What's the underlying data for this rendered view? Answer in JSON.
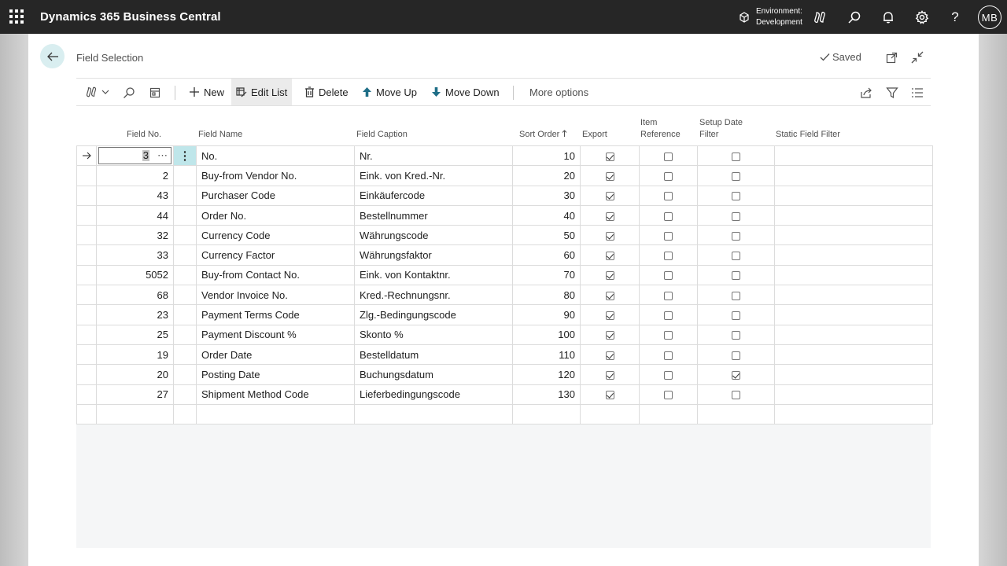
{
  "app": {
    "title": "Dynamics 365 Business Central",
    "environment_line1": "Environment:",
    "environment_line2": "Development",
    "user_initials": "MB"
  },
  "page": {
    "title": "Field Selection",
    "saved_label": "Saved"
  },
  "actions": {
    "new": "New",
    "edit_list": "Edit List",
    "delete": "Delete",
    "move_up": "Move Up",
    "move_down": "Move Down",
    "more_options": "More options"
  },
  "columns": {
    "field_no": "Field No.",
    "field_name": "Field Name",
    "field_caption": "Field Caption",
    "sort_order": "Sort Order",
    "export": "Export",
    "item_reference_1": "Item",
    "item_reference_2": "Reference",
    "setup_date_filter_1": "Setup Date",
    "setup_date_filter_2": "Filter",
    "static_field_filter": "Static Field Filter"
  },
  "rows": [
    {
      "field_no": "3",
      "field_name": "No.",
      "field_caption": "Nr.",
      "sort_order": "10",
      "export": true,
      "item_reference": false,
      "setup_date_filter": false
    },
    {
      "field_no": "2",
      "field_name": "Buy-from Vendor No.",
      "field_caption": "Eink. von Kred.-Nr.",
      "sort_order": "20",
      "export": true,
      "item_reference": false,
      "setup_date_filter": false
    },
    {
      "field_no": "43",
      "field_name": "Purchaser Code",
      "field_caption": "Einkäufercode",
      "sort_order": "30",
      "export": true,
      "item_reference": false,
      "setup_date_filter": false
    },
    {
      "field_no": "44",
      "field_name": "Order No.",
      "field_caption": "Bestellnummer",
      "sort_order": "40",
      "export": true,
      "item_reference": false,
      "setup_date_filter": false
    },
    {
      "field_no": "32",
      "field_name": "Currency Code",
      "field_caption": "Währungscode",
      "sort_order": "50",
      "export": true,
      "item_reference": false,
      "setup_date_filter": false
    },
    {
      "field_no": "33",
      "field_name": "Currency Factor",
      "field_caption": "Währungsfaktor",
      "sort_order": "60",
      "export": true,
      "item_reference": false,
      "setup_date_filter": false
    },
    {
      "field_no": "5052",
      "field_name": "Buy-from Contact No.",
      "field_caption": "Eink. von Kontaktnr.",
      "sort_order": "70",
      "export": true,
      "item_reference": false,
      "setup_date_filter": false
    },
    {
      "field_no": "68",
      "field_name": "Vendor Invoice No.",
      "field_caption": "Kred.-Rechnungsnr.",
      "sort_order": "80",
      "export": true,
      "item_reference": false,
      "setup_date_filter": false
    },
    {
      "field_no": "23",
      "field_name": "Payment Terms Code",
      "field_caption": "Zlg.-Bedingungscode",
      "sort_order": "90",
      "export": true,
      "item_reference": false,
      "setup_date_filter": false
    },
    {
      "field_no": "25",
      "field_name": "Payment Discount %",
      "field_caption": "Skonto %",
      "sort_order": "100",
      "export": true,
      "item_reference": false,
      "setup_date_filter": false
    },
    {
      "field_no": "19",
      "field_name": "Order Date",
      "field_caption": "Bestelldatum",
      "sort_order": "110",
      "export": true,
      "item_reference": false,
      "setup_date_filter": false
    },
    {
      "field_no": "20",
      "field_name": "Posting Date",
      "field_caption": "Buchungsdatum",
      "sort_order": "120",
      "export": true,
      "item_reference": false,
      "setup_date_filter": true
    },
    {
      "field_no": "27",
      "field_name": "Shipment Method Code",
      "field_caption": "Lieferbedingungscode",
      "sort_order": "130",
      "export": true,
      "item_reference": false,
      "setup_date_filter": false
    }
  ],
  "colors": {
    "app_bar": "#262626",
    "accent": "#00b7c3",
    "selected_cell": "#bfe6ea"
  }
}
